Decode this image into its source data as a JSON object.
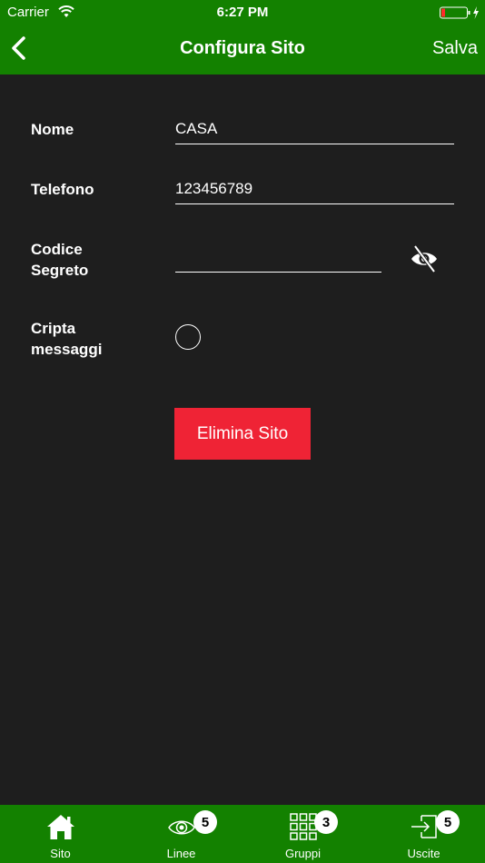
{
  "status_bar": {
    "carrier": "Carrier",
    "time": "6:27 PM"
  },
  "nav": {
    "title": "Configura Sito",
    "save_label": "Salva"
  },
  "form": {
    "name_label": "Nome",
    "name_value": "CASA",
    "phone_label": "Telefono",
    "phone_value": "123456789",
    "secret_label_line1": "Codice",
    "secret_label_line2": "Segreto",
    "secret_value": "",
    "encrypt_label_line1": "Cripta",
    "encrypt_label_line2": "messaggi",
    "encrypt_checked": false,
    "delete_label": "Elimina Sito"
  },
  "tabs": [
    {
      "label": "Sito",
      "icon": "home-icon",
      "badge": ""
    },
    {
      "label": "Linee",
      "icon": "eye-icon",
      "badge": "5"
    },
    {
      "label": "Gruppi",
      "icon": "grid-icon",
      "badge": "3"
    },
    {
      "label": "Uscite",
      "icon": "exit-icon",
      "badge": "5"
    }
  ],
  "colors": {
    "header_green": "#138100",
    "background": "#1e1e1e",
    "delete_red": "#ef2335"
  }
}
